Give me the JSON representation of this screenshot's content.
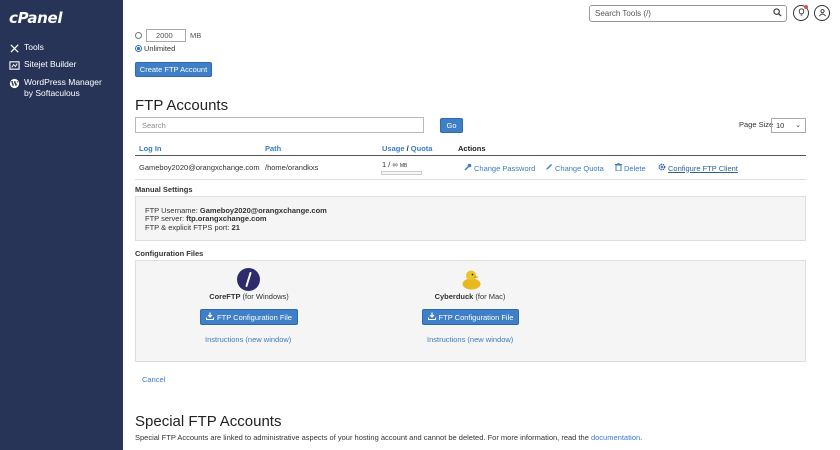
{
  "sidebar": {
    "logo": "cPanel",
    "items": [
      {
        "label": "Tools",
        "icon": "tools-icon"
      },
      {
        "label": "Sitejet Builder",
        "icon": "sitejet-icon"
      },
      {
        "label": "WordPress Manager",
        "label2": "by Softaculous",
        "icon": "wordpress-icon"
      }
    ]
  },
  "header": {
    "search_placeholder": "Search Tools (/)"
  },
  "quota": {
    "value": "2000",
    "unit": "MB",
    "unlimited_label": "Unlimited"
  },
  "create_button": "Create FTP Account",
  "ftp_accounts": {
    "title": "FTP Accounts",
    "search_placeholder": "Search",
    "go_label": "Go",
    "page_size_label": "Page Size",
    "page_size_value": "10",
    "columns": {
      "login": "Log In",
      "path": "Path",
      "usage": "Usage",
      "sep": " / ",
      "quota": "Quota",
      "actions": "Actions"
    },
    "row": {
      "login": "Gameboy2020@orangxchange.com",
      "path": "/home/orandkxs",
      "usage": "1 / ∞",
      "usage_unit": "MB",
      "actions": [
        "Change Password",
        "Change Quota",
        "Delete",
        "Configure FTP Client"
      ]
    }
  },
  "manual_settings": {
    "title": "Manual Settings",
    "username_label": "FTP Username:",
    "username": "Gameboy2020@orangxchange.com",
    "server_label": "FTP server:",
    "server": "ftp.orangxchange.com",
    "port_label": "FTP & explicit FTPS port:",
    "port": "21"
  },
  "config_files": {
    "title": "Configuration Files",
    "clients": [
      {
        "name": "CoreFTP",
        "platform": "(for Windows)",
        "button": "FTP Configuration File",
        "instructions": "Instructions (new window)"
      },
      {
        "name": "Cyberduck",
        "platform": "(for Mac)",
        "button": "FTP Configuration File",
        "instructions": "Instructions (new window)"
      }
    ]
  },
  "cancel_label": "Cancel",
  "special": {
    "title": "Special FTP Accounts",
    "desc": "Special FTP Accounts are linked to administrative aspects of your hosting account and cannot be deleted. For more information, read the",
    "link": "documentation",
    "end": "."
  }
}
